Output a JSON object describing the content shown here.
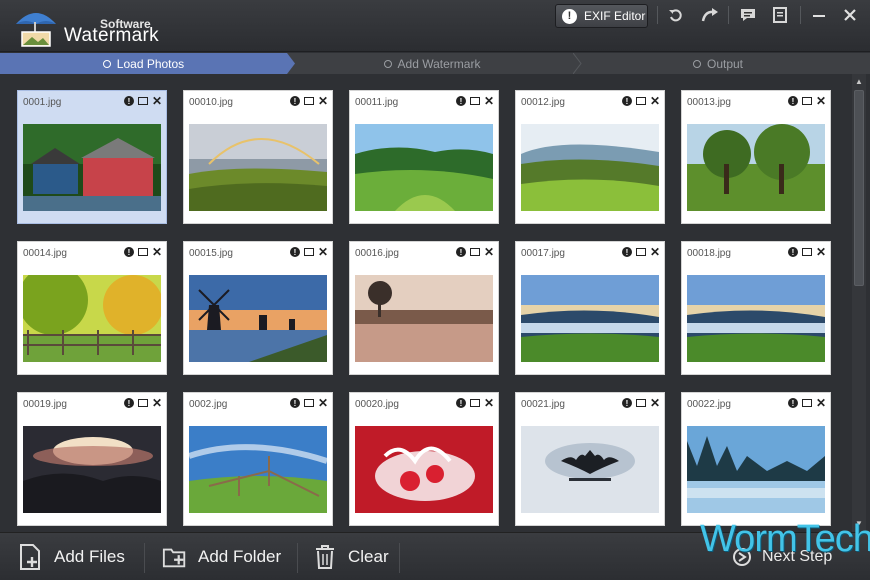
{
  "app": {
    "brand_small": "Software",
    "brand_big": "Watermark"
  },
  "toolbar": {
    "exif_label": "EXIF Editor",
    "icons": [
      "undo-icon",
      "redo-icon",
      "feedback-icon",
      "notes-icon",
      "minimize-icon",
      "close-icon"
    ]
  },
  "steps": [
    {
      "label": "Load Photos",
      "active": true
    },
    {
      "label": "Add Watermark",
      "active": false
    },
    {
      "label": "Output",
      "active": false
    }
  ],
  "photos": [
    {
      "name": "0001.jpg",
      "selected": true
    },
    {
      "name": "00010.jpg"
    },
    {
      "name": "00011.jpg"
    },
    {
      "name": "00012.jpg"
    },
    {
      "name": "00013.jpg"
    },
    {
      "name": "00014.jpg"
    },
    {
      "name": "00015.jpg"
    },
    {
      "name": "00016.jpg"
    },
    {
      "name": "00017.jpg"
    },
    {
      "name": "00018.jpg"
    },
    {
      "name": "00019.jpg"
    },
    {
      "name": "0002.jpg"
    },
    {
      "name": "00020.jpg"
    },
    {
      "name": "00021.jpg"
    },
    {
      "name": "00022.jpg"
    }
  ],
  "bottom": {
    "add_files": "Add Files",
    "add_folder": "Add Folder",
    "clear": "Clear",
    "next_step": "Next Step"
  },
  "overlay_text": "WormTechs",
  "colors": {
    "active_step": "#5a74b4",
    "selected_card": "#cfdcf2",
    "overlay": "#43c4e8"
  }
}
